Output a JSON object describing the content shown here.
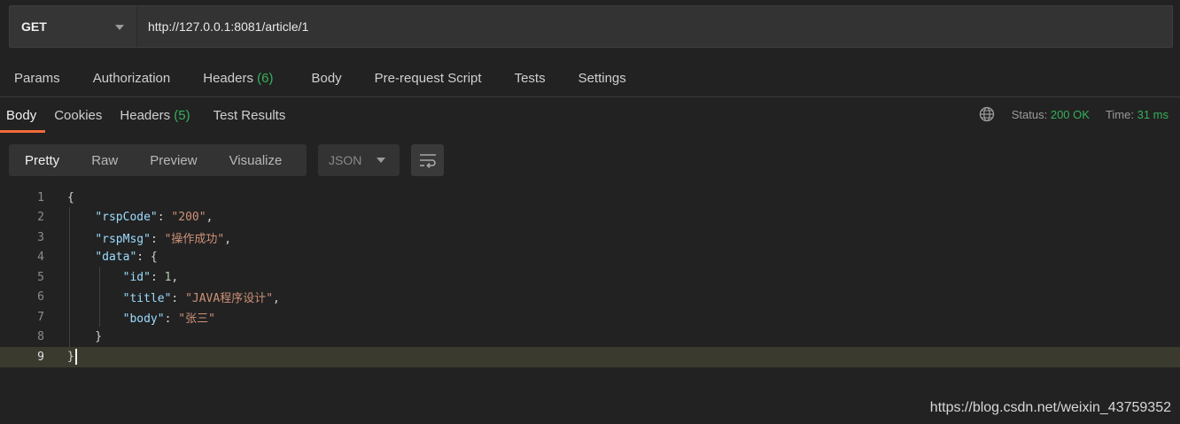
{
  "request": {
    "method": "GET",
    "url": "http://127.0.0.1:8081/article/1"
  },
  "request_tabs": {
    "params": "Params",
    "authorization": "Authorization",
    "headers": "Headers",
    "headers_count": "(6)",
    "body": "Body",
    "prerequest": "Pre-request Script",
    "tests": "Tests",
    "settings": "Settings"
  },
  "response_tabs": {
    "body": "Body",
    "cookies": "Cookies",
    "headers": "Headers",
    "headers_count": "(5)",
    "test_results": "Test Results"
  },
  "status": {
    "status_label": "Status:",
    "status_value": "200 OK",
    "time_label": "Time:",
    "time_value": "31 ms"
  },
  "view": {
    "pretty": "Pretty",
    "raw": "Raw",
    "preview": "Preview",
    "visualize": "Visualize",
    "format": "JSON"
  },
  "lines": [
    {
      "no": "1"
    },
    {
      "no": "2"
    },
    {
      "no": "3"
    },
    {
      "no": "4"
    },
    {
      "no": "5"
    },
    {
      "no": "6"
    },
    {
      "no": "7"
    },
    {
      "no": "8"
    },
    {
      "no": "9"
    }
  ],
  "json": {
    "k_rspCode": "\"rspCode\"",
    "v_rspCode": "\"200\"",
    "k_rspMsg": "\"rspMsg\"",
    "v_rspMsg": "\"操作成功\"",
    "k_data": "\"data\"",
    "k_id": "\"id\"",
    "v_id": "1",
    "k_title": "\"title\"",
    "v_title": "\"JAVA程序设计\"",
    "k_body": "\"body\"",
    "v_body": "\"张三\""
  },
  "watermark": "https://blog.csdn.net/weixin_43759352",
  "colors": {
    "accent": "#f26b3a",
    "success": "#36b05a"
  }
}
